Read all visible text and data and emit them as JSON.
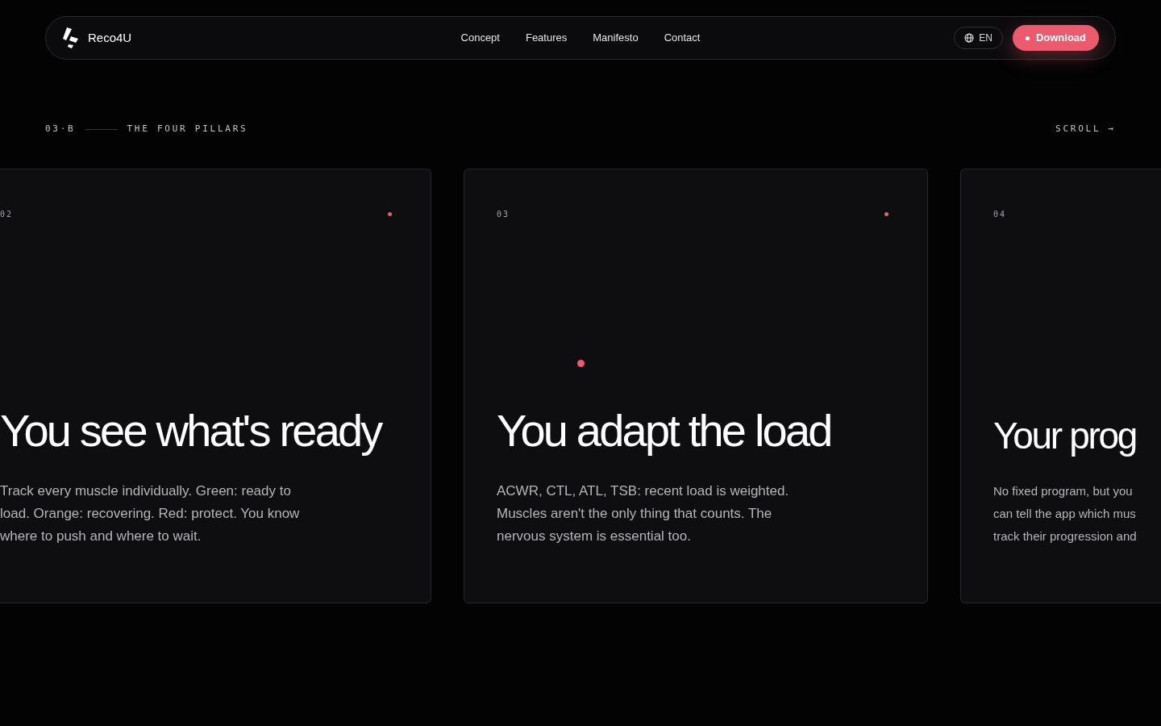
{
  "nav": {
    "brand": "Reco4U",
    "links": [
      "Concept",
      "Features",
      "Manifesto",
      "Contact"
    ],
    "language": "EN",
    "download": "Download"
  },
  "section": {
    "index": "03·B",
    "title": "THE FOUR PILLARS",
    "scroll": "SCROLL →"
  },
  "cards": [
    {
      "number": "02",
      "title": "You see what's ready",
      "body_lines": [
        "Track every muscle individually. Green: ready to",
        "load. Orange: recovering. Red: protect. You know",
        "where to push and where to wait."
      ],
      "center_dot": false,
      "cut_right": false
    },
    {
      "number": "03",
      "title": "You adapt the load",
      "body_lines": [
        "ACWR, CTL, ATL, TSB: recent load is weighted.",
        "Muscles aren't the only thing that counts. The",
        "nervous system is essential too."
      ],
      "center_dot": true,
      "cut_right": false
    },
    {
      "number": "04",
      "title": "Your prog",
      "body_lines": [
        "No fixed program, but you",
        "can tell the app which mus",
        "track their progression and"
      ],
      "center_dot": false,
      "cut_right": true
    }
  ]
}
